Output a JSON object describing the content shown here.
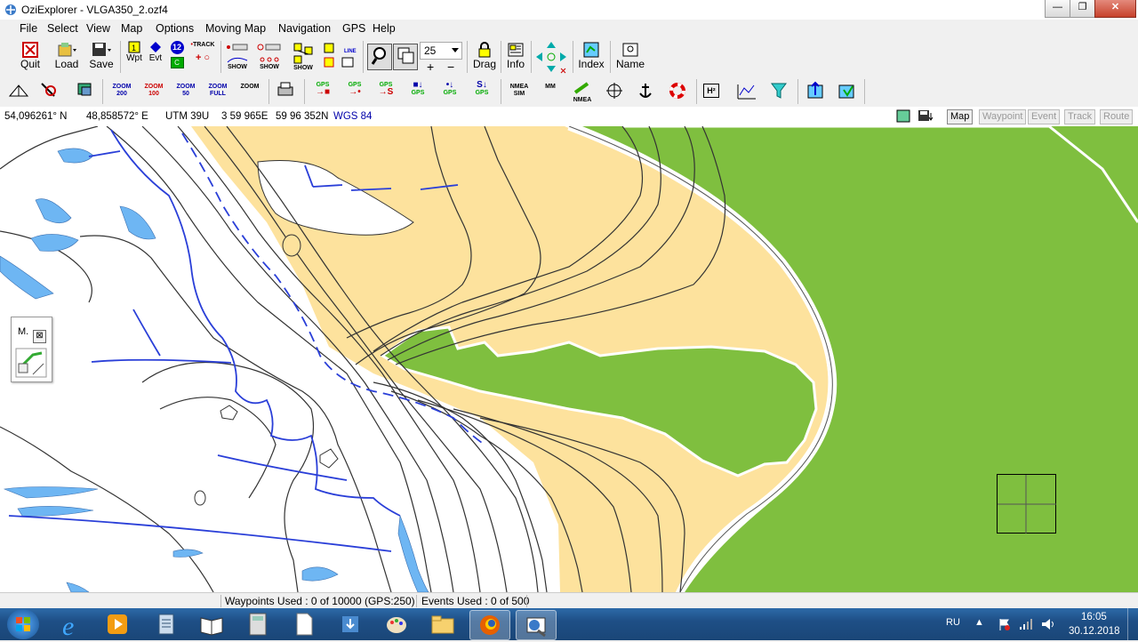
{
  "window": {
    "title": "OziExplorer - VLGA350_2.ozf4",
    "minimize": "—",
    "maximize": "❐",
    "close": "✕"
  },
  "menu": [
    "File",
    "Select",
    "View",
    "Map",
    "Options",
    "Moving Map",
    "Navigation",
    "GPS",
    "Help"
  ],
  "toolbar": {
    "quit": "Quit",
    "load": "Load",
    "save": "Save",
    "wpt": "Wpt",
    "evt": "Evt",
    "track": "TRACK",
    "show": "SHOW",
    "line": "LINE",
    "zoom_value": "25",
    "drag": "Drag",
    "info": "Info",
    "index": "Index",
    "name": "Name",
    "wp_number": "12",
    "c_label": "C"
  },
  "toolbar2": {
    "zoom200": "ZOOM 200",
    "zoom100": "ZOOM 100",
    "zoom50": "ZOOM 50",
    "zoomfull": "ZOOM FULL",
    "zoom": "ZOOM",
    "gps": "GPS",
    "nmea_sim": "NMEA SIM",
    "mm": "MM",
    "nmea": "NMEA",
    "h2": "H²"
  },
  "coords": {
    "lat": "54,096261° N",
    "lon": "48,858572° E",
    "utm_zone": "UTM  39U",
    "easting": "3 59 965E",
    "northing": "59 96 352N",
    "datum": "WGS 84"
  },
  "map_tabs": [
    {
      "label": "Map",
      "enabled": true
    },
    {
      "label": "Waypoint",
      "enabled": false
    },
    {
      "label": "Event",
      "enabled": false
    },
    {
      "label": "Track",
      "enabled": false
    },
    {
      "label": "Route",
      "enabled": false
    }
  ],
  "mini_panel": {
    "label": "M."
  },
  "status": {
    "waypoints": "Waypoints Used : 0 of 10000  (GPS:250)",
    "events": "Events Used : 0 of 500"
  },
  "taskbar": {
    "lang": "RU",
    "time": "16:05",
    "date": "30.12.2018"
  },
  "colors": {
    "map_green": "#7fbf3f",
    "map_sand": "#fde29d",
    "water": "#6eb6f3",
    "stream": "#2a3fd8",
    "contour": "#333333"
  }
}
